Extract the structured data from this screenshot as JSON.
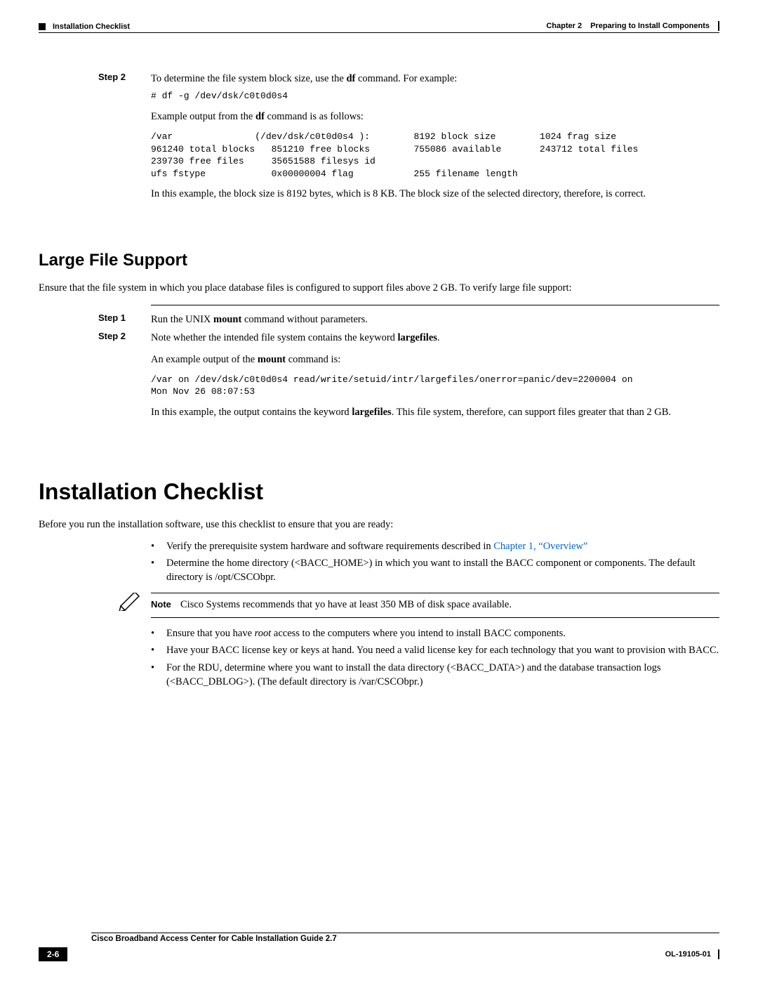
{
  "header": {
    "chapter_label": "Chapter 2",
    "chapter_title": "Preparing to Install Components",
    "section_title": "Installation Checklist"
  },
  "step2": {
    "label": "Step 2",
    "intro_a": "To determine the file system block size, use the ",
    "intro_cmd": "df",
    "intro_b": " command. For example:",
    "cmd": "# df -g /dev/dsk/c0t0d0s4",
    "ex_a": "Example output from the ",
    "ex_cmd": "df",
    "ex_b": " command is as follows:",
    "output": "/var               (/dev/dsk/c0t0d0s4 ):        8192 block size        1024 frag size\n961240 total blocks   851210 free blocks        755086 available       243712 total files\n239730 free files     35651588 filesys id\nufs fstype            0x00000004 flag           255 filename length",
    "tail": "In this example, the block size is 8192 bytes, which is 8 KB. The block size of the selected directory, therefore, is correct."
  },
  "lfs": {
    "heading": "Large File Support",
    "intro": "Ensure that the file system in which you place database files is configured to support files above 2 GB. To verify large file support:",
    "step1": {
      "label": "Step 1",
      "a": "Run the UNIX ",
      "cmd": "mount",
      "b": " command without parameters."
    },
    "step2": {
      "label": "Step 2",
      "a": "Note whether the intended file system contains the keyword ",
      "kw": "largefiles",
      "b": "."
    },
    "ex_a": "An example output of the ",
    "ex_cmd": "mount",
    "ex_b": " command is:",
    "output": "/var on /dev/dsk/c0t0d0s4 read/write/setuid/intr/largefiles/onerror=panic/dev=2200004 on\nMon Nov 26 08:07:53",
    "tail_a": "In this example, the output contains the keyword ",
    "tail_kw": "largefiles",
    "tail_b": ". This file system, therefore, can support files greater that than 2 GB."
  },
  "checklist": {
    "heading": "Installation Checklist",
    "intro": "Before you run the installation software, use this checklist to ensure that you are ready:",
    "b1_a": "Verify the prerequisite system hardware and software requirements described in ",
    "b1_link": "Chapter 1, “Overview”",
    "b2": "Determine the home directory (<BACC_HOME>) in which you want to install the BACC component or components. The default directory is /opt/CSCObpr.",
    "note_label": "Note",
    "note_text": "Cisco Systems recommends that yo have at least 350 MB of disk space available.",
    "b3_a": "Ensure that you have ",
    "b3_i": "root",
    "b3_b": " access to the computers where you intend to install BACC components.",
    "b4": "Have your BACC license key or keys at hand. You need a valid license key for each technology that you want to provision with BACC.",
    "b5": "For the RDU, determine where you want to install the data directory (<BACC_DATA>) and the database transaction logs (<BACC_DBLOG>). (The default directory is /var/CSCObpr.)"
  },
  "footer": {
    "guide": "Cisco Broadband Access Center for Cable Installation Guide 2.7",
    "page": "2-6",
    "pub": "OL-19105-01"
  }
}
